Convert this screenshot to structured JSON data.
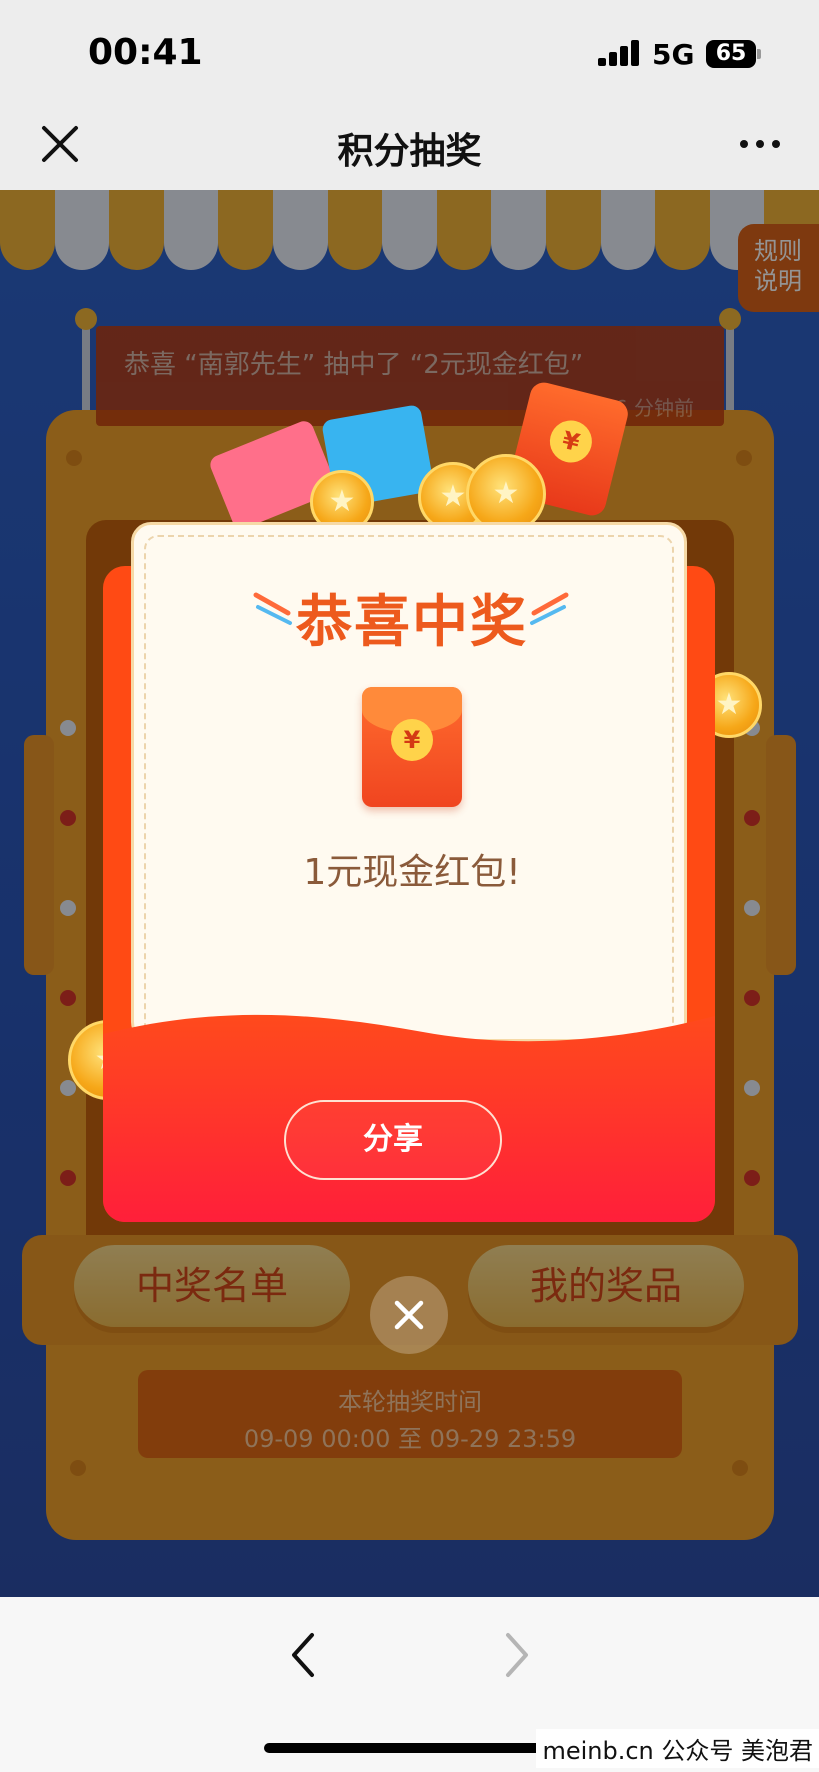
{
  "status_bar": {
    "time": "00:41",
    "network": "5G",
    "battery": "65"
  },
  "nav": {
    "title": "积分抽奖",
    "close_icon": "close-icon",
    "more_icon": "more-icon"
  },
  "page": {
    "rules_label_line1": "规则",
    "rules_label_line2": "说明",
    "banner_text": "恭喜 “南郭先生” 抽中了 “2元现金红包”",
    "banner_time": "6 分钟前",
    "winners_button": "中奖名单",
    "my_prizes_button": "我的奖品",
    "round_time_label": "本轮抽奖时间",
    "round_time_range": "09-09 00:00 至 09-29 23:59"
  },
  "modal": {
    "title": "恭喜中奖",
    "prize_icon": "red-envelope-icon",
    "prize_symbol": "¥",
    "prize_text": "1元现金红包!",
    "share_button": "分享",
    "close_icon": "close-icon"
  },
  "colors": {
    "accent_orange": "#ed5a1d",
    "modal_red": "#ff4a14",
    "page_blue": "#2e62c8",
    "machine_gold": "#f0a12b"
  },
  "bottom_bar": {
    "back_icon": "chevron-left-icon",
    "forward_icon": "chevron-right-icon"
  },
  "watermark": "meinb.cn  公众号 美泡君"
}
